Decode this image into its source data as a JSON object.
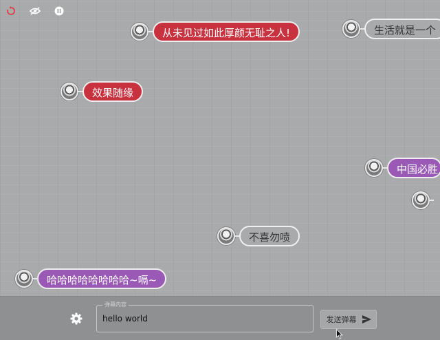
{
  "controls": {
    "refresh_icon": "refresh-icon",
    "hide_icon": "eye-off-icon",
    "pause_icon": "pause-icon",
    "refresh_color": "#e0404a"
  },
  "danmu": [
    {
      "text": "从未见过如此厚颜无耻之人!",
      "style": "red"
    },
    {
      "text": "生活就是一个",
      "style": "grey"
    },
    {
      "text": "效果随缘",
      "style": "red"
    },
    {
      "text": "中国必胜",
      "style": "purple"
    },
    {
      "text": "不喜勿喷",
      "style": "grey"
    },
    {
      "text": "哈哈哈哈哈哈哈哈~嗝~",
      "style": "purple"
    }
  ],
  "bottom_bar": {
    "settings_icon": "gear-icon",
    "input_label": "弹幕内容",
    "input_value": "hello world",
    "send_label": "发送弹幕",
    "send_icon": "send-icon"
  },
  "colors": {
    "red": "#c8313e",
    "purple": "#9b59b6",
    "background": "#a9aaab"
  }
}
